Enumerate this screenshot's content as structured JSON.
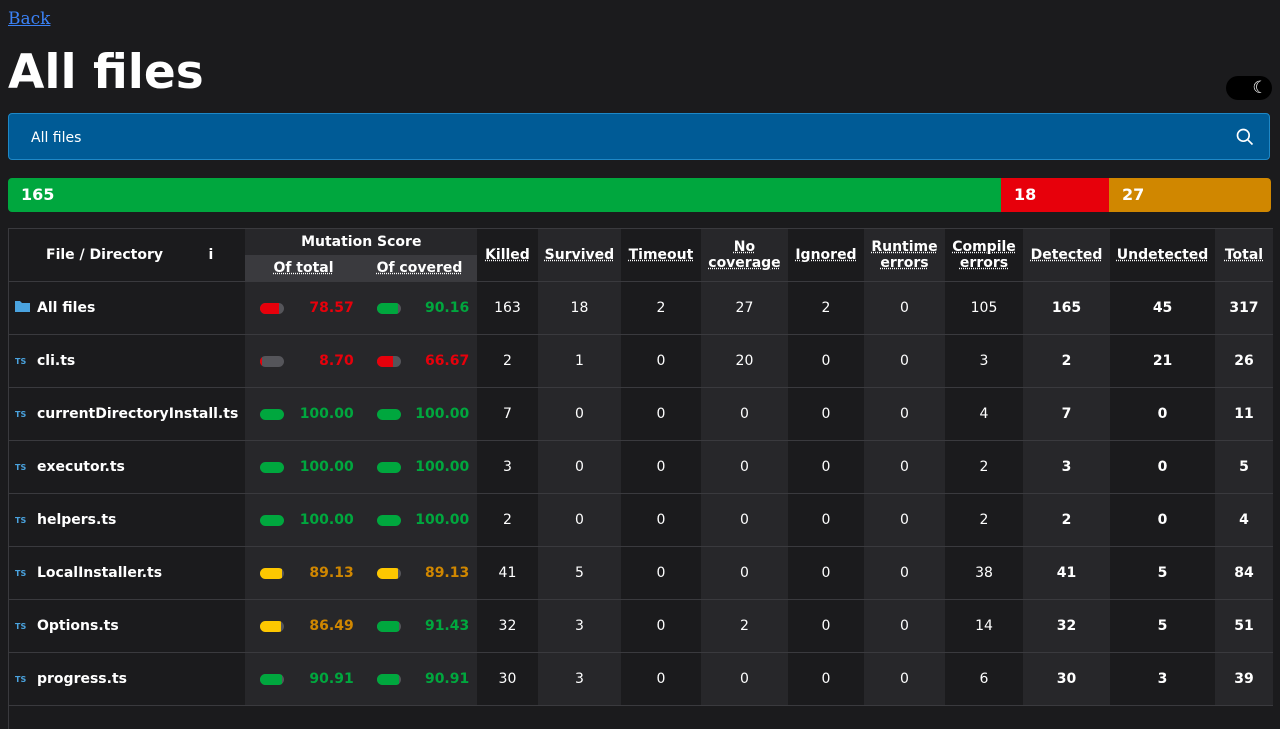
{
  "nav": {
    "back_label": "Back"
  },
  "page": {
    "title": "All files"
  },
  "theme_toggle": {
    "icon": "moon-icon",
    "symbol": "☾"
  },
  "search": {
    "value": "All files",
    "icon": "search-icon"
  },
  "summary_bar": {
    "detected": "165",
    "survived": "18",
    "no_coverage": "27",
    "colors": {
      "detected": "#00a73e",
      "survived": "#e7000b",
      "no_coverage": "#d08700"
    }
  },
  "table": {
    "headers": {
      "file": "File / Directory",
      "info": "i",
      "mutation_score": "Mutation Score",
      "of_total": "Of total",
      "of_covered": "Of covered",
      "killed": "Killed",
      "survived": "Survived",
      "timeout": "Timeout",
      "no_coverage_1": "No",
      "no_coverage_2": "coverage",
      "ignored": "Ignored",
      "runtime_1": "Runtime",
      "runtime_2": "errors",
      "compile_1": "Compile",
      "compile_2": "errors",
      "detected": "Detected",
      "undetected": "Undetected",
      "total": "Total"
    },
    "rows": [
      {
        "name": "All files",
        "icon": "folder-icon",
        "total_score": "78.57",
        "total_pct": 78.57,
        "total_color": "red",
        "covered_score": "90.16",
        "covered_pct": 90.16,
        "covered_color": "green",
        "killed": "163",
        "survived": "18",
        "timeout": "2",
        "no_coverage": "27",
        "ignored": "2",
        "runtime": "0",
        "compile": "105",
        "detected": "165",
        "undetected": "45",
        "total": "317"
      },
      {
        "name": "cli.ts",
        "icon": "ts-file-icon",
        "total_score": "8.70",
        "total_pct": 8.7,
        "total_color": "red",
        "covered_score": "66.67",
        "covered_pct": 66.67,
        "covered_color": "red",
        "killed": "2",
        "survived": "1",
        "timeout": "0",
        "no_coverage": "20",
        "ignored": "0",
        "runtime": "0",
        "compile": "3",
        "detected": "2",
        "undetected": "21",
        "total": "26"
      },
      {
        "name": "currentDirectoryInstall.ts",
        "icon": "ts-file-icon",
        "total_score": "100.00",
        "total_pct": 100,
        "total_color": "green",
        "covered_score": "100.00",
        "covered_pct": 100,
        "covered_color": "green",
        "killed": "7",
        "survived": "0",
        "timeout": "0",
        "no_coverage": "0",
        "ignored": "0",
        "runtime": "0",
        "compile": "4",
        "detected": "7",
        "undetected": "0",
        "total": "11"
      },
      {
        "name": "executor.ts",
        "icon": "ts-file-icon",
        "total_score": "100.00",
        "total_pct": 100,
        "total_color": "green",
        "covered_score": "100.00",
        "covered_pct": 100,
        "covered_color": "green",
        "killed": "3",
        "survived": "0",
        "timeout": "0",
        "no_coverage": "0",
        "ignored": "0",
        "runtime": "0",
        "compile": "2",
        "detected": "3",
        "undetected": "0",
        "total": "5"
      },
      {
        "name": "helpers.ts",
        "icon": "ts-file-icon",
        "total_score": "100.00",
        "total_pct": 100,
        "total_color": "green",
        "covered_score": "100.00",
        "covered_pct": 100,
        "covered_color": "green",
        "killed": "2",
        "survived": "0",
        "timeout": "0",
        "no_coverage": "0",
        "ignored": "0",
        "runtime": "0",
        "compile": "2",
        "detected": "2",
        "undetected": "0",
        "total": "4"
      },
      {
        "name": "LocalInstaller.ts",
        "icon": "ts-file-icon",
        "total_score": "89.13",
        "total_pct": 89.13,
        "total_color": "yellow",
        "covered_score": "89.13",
        "covered_pct": 89.13,
        "covered_color": "yellow",
        "killed": "41",
        "survived": "5",
        "timeout": "0",
        "no_coverage": "0",
        "ignored": "0",
        "runtime": "0",
        "compile": "38",
        "detected": "41",
        "undetected": "5",
        "total": "84"
      },
      {
        "name": "Options.ts",
        "icon": "ts-file-icon",
        "total_score": "86.49",
        "total_pct": 86.49,
        "total_color": "yellow",
        "covered_score": "91.43",
        "covered_pct": 91.43,
        "covered_color": "green",
        "killed": "32",
        "survived": "3",
        "timeout": "0",
        "no_coverage": "2",
        "ignored": "0",
        "runtime": "0",
        "compile": "14",
        "detected": "32",
        "undetected": "5",
        "total": "51"
      },
      {
        "name": "progress.ts",
        "icon": "ts-file-icon",
        "total_score": "90.91",
        "total_pct": 90.91,
        "total_color": "green",
        "covered_score": "90.91",
        "covered_pct": 90.91,
        "covered_color": "green",
        "killed": "30",
        "survived": "3",
        "timeout": "0",
        "no_coverage": "0",
        "ignored": "0",
        "runtime": "0",
        "compile": "6",
        "detected": "30",
        "undetected": "3",
        "total": "39"
      }
    ],
    "colors": {
      "green": "#00a73e",
      "red": "#e7000b",
      "yellow": "#d08700",
      "bar_yellow": "#fdc700"
    }
  }
}
